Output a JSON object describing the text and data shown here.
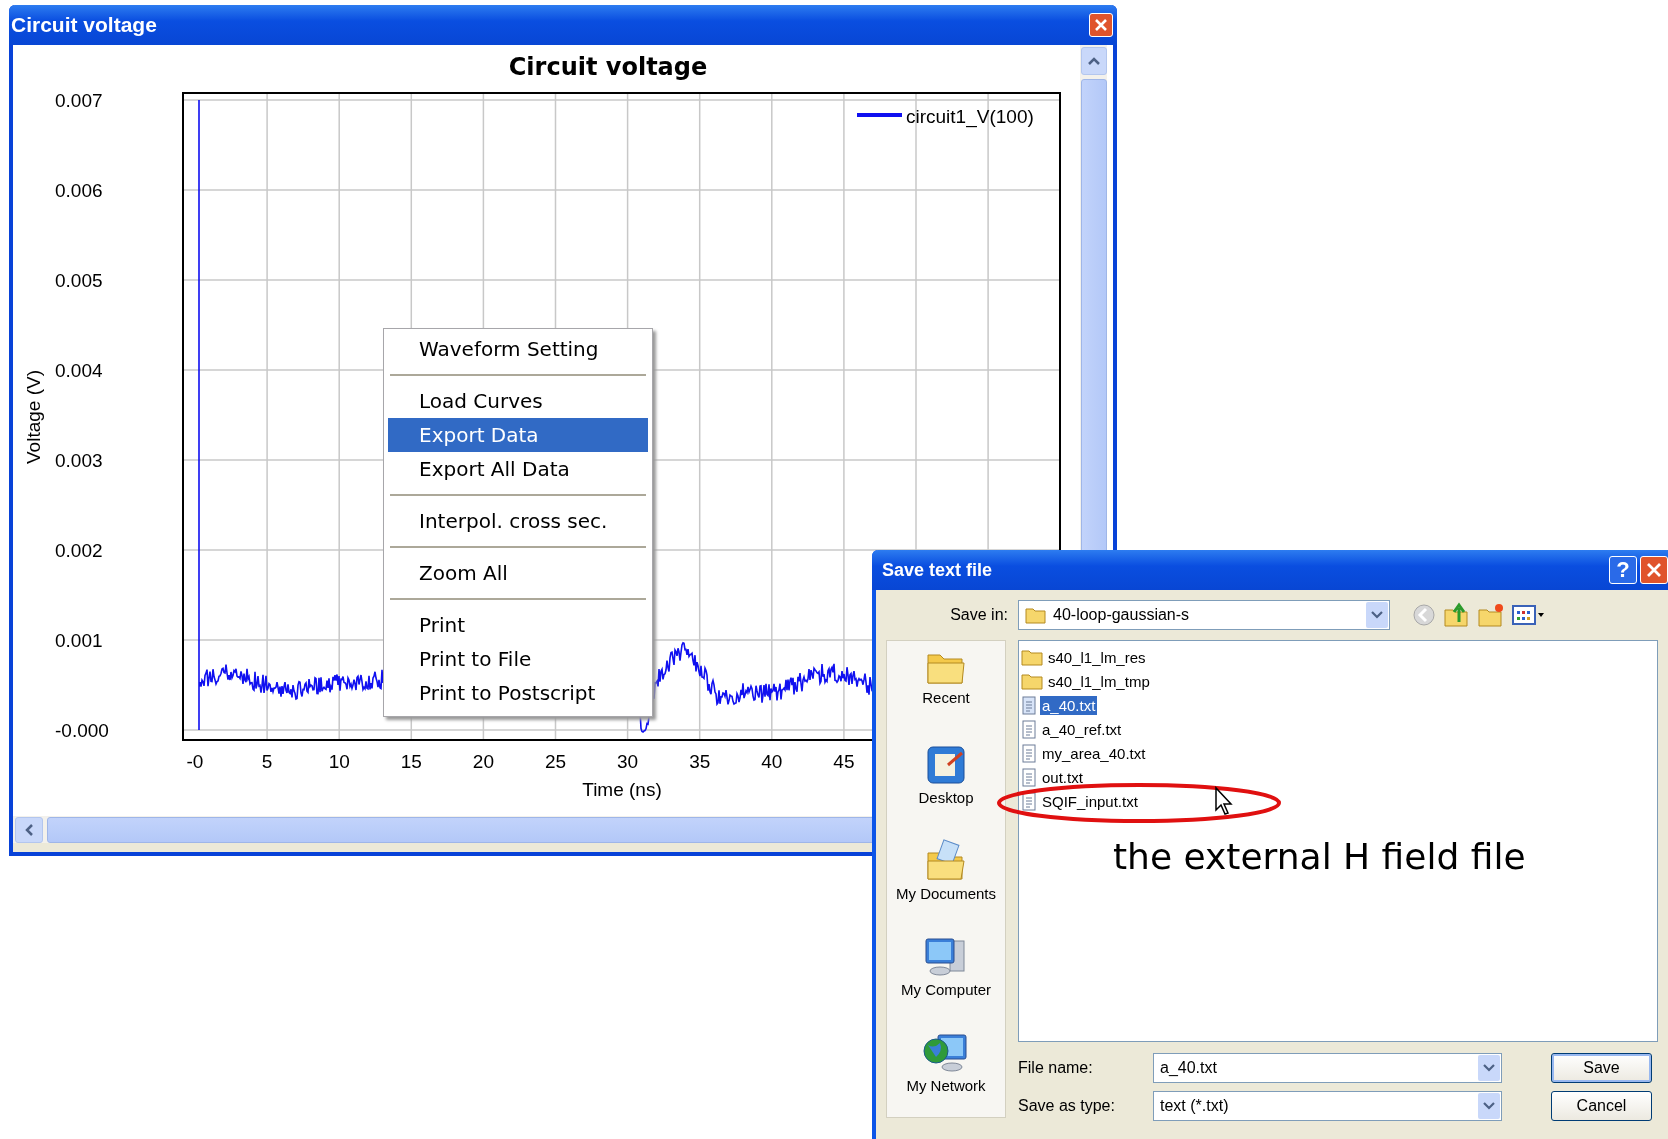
{
  "main_window": {
    "title": "Circuit voltage"
  },
  "chart": {
    "title": "Circuit voltage",
    "ylabel": "Voltage (V)",
    "xlabel": "Time (ns)",
    "yticks": [
      "0.007",
      "0.006",
      "0.005",
      "0.004",
      "0.003",
      "0.002",
      "0.001",
      "-0.000"
    ],
    "xticks": [
      "-0",
      "5",
      "10",
      "15",
      "20",
      "25",
      "30",
      "35",
      "40",
      "45"
    ],
    "legend": "circuit1_V(100)"
  },
  "context_menu": {
    "groups": [
      [
        {
          "label": "Waveform Setting",
          "selected": false
        }
      ],
      [
        {
          "label": "Load Curves",
          "selected": false
        },
        {
          "label": "Export Data",
          "selected": true
        },
        {
          "label": "Export All Data",
          "selected": false
        }
      ],
      [
        {
          "label": "Interpol. cross sec.",
          "selected": false
        }
      ],
      [
        {
          "label": "Zoom All",
          "selected": false
        }
      ],
      [
        {
          "label": "Print",
          "selected": false
        },
        {
          "label": "Print to File",
          "selected": false
        },
        {
          "label": "Print to Postscript",
          "selected": false
        }
      ]
    ]
  },
  "save_dialog": {
    "title": "Save text file",
    "help": "?",
    "save_in_label": "Save in:",
    "save_in_value": "40-loop-gaussian-s",
    "places": [
      "Recent",
      "Desktop",
      "My Documents",
      "My Computer",
      "My Network"
    ],
    "files": [
      {
        "name": "s40_l1_lm_res",
        "kind": "folder",
        "selected": false
      },
      {
        "name": "s40_l1_lm_tmp",
        "kind": "folder",
        "selected": false
      },
      {
        "name": "a_40.txt",
        "kind": "file",
        "selected": true
      },
      {
        "name": "a_40_ref.txt",
        "kind": "file",
        "selected": false
      },
      {
        "name": "my_area_40.txt",
        "kind": "file",
        "selected": false
      },
      {
        "name": "out.txt",
        "kind": "file",
        "selected": false
      },
      {
        "name": "SQIF_input.txt",
        "kind": "file",
        "selected": false
      }
    ],
    "file_name_label": "File name:",
    "file_name": "a_40.txt",
    "type_label": "Save as type:",
    "type_value": "text (*.txt)",
    "buttons": [
      "Save",
      "Cancel"
    ]
  },
  "annotation": {
    "text": "the external H field file"
  }
}
